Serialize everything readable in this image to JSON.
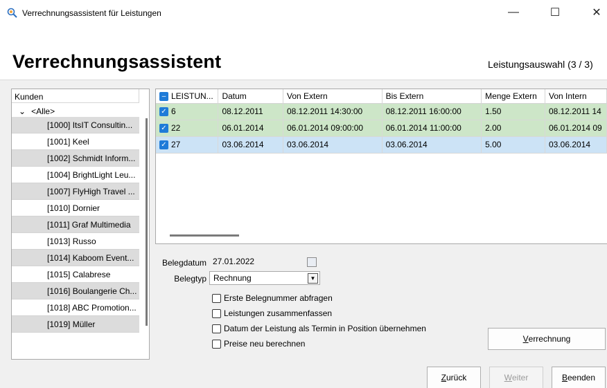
{
  "window": {
    "title": "Verrechnungsassistent für Leistungen",
    "min_glyph": "—",
    "max_glyph": "☐",
    "close_glyph": "✕"
  },
  "header": {
    "title": "Verrechnungsassistent",
    "step": "Leistungsauswahl (3 / 3)"
  },
  "customers": {
    "column": "Kunden",
    "all_toggle": "⌄",
    "all_label": "<Alle>",
    "items": [
      "[1000] ItsIT Consultin...",
      "[1001] Keel",
      "[1002] Schmidt Inform...",
      "[1004] BrightLight Leu...",
      "[1007] FlyHigh Travel ...",
      "[1010] Dornier",
      "[1011] Graf Multimedia",
      "[1013] Russo",
      "[1014] Kaboom Event...",
      "[1015] Calabrese",
      "[1016] Boulangerie Ch...",
      "[1018] ABC Promotion...",
      "[1019] Müller"
    ]
  },
  "services": {
    "columns": [
      "LEISTUN...",
      "Datum",
      "Von Extern",
      "Bis Extern",
      "Menge Extern",
      "Von Intern"
    ],
    "rows": [
      {
        "id": "6",
        "datum": "08.12.2011",
        "von": "08.12.2011 14:30:00",
        "bis": "08.12.2011 16:00:00",
        "menge": "1.50",
        "von_intern": "08.12.2011 14",
        "status": "green"
      },
      {
        "id": "22",
        "datum": "06.01.2014",
        "von": "06.01.2014 09:00:00",
        "bis": "06.01.2014 11:00:00",
        "menge": "2.00",
        "von_intern": "06.01.2014 09",
        "status": "green"
      },
      {
        "id": "27",
        "datum": "03.06.2014",
        "von": "03.06.2014",
        "bis": "03.06.2014",
        "menge": "5.00",
        "von_intern": "03.06.2014",
        "status": "blue"
      }
    ]
  },
  "form": {
    "belegdatum_label": "Belegdatum",
    "belegdatum_value": "27.01.2022",
    "belegtyp_label": "Belegtyp",
    "belegtyp_value": "Rechnung",
    "options": [
      "Erste Belegnummer abfragen",
      "Leistungen zusammenfassen",
      "Datum der Leistung als Termin in Position übernehmen",
      "Preise neu berechnen"
    ]
  },
  "buttons": {
    "verrechnung_mn": "V",
    "verrechnung_rest": "errechnung",
    "zurueck_mn": "Z",
    "zurueck_rest": "urück",
    "weiter_mn": "W",
    "weiter_rest": "eiter",
    "beenden_mn": "B",
    "beenden_rest": "eenden"
  }
}
